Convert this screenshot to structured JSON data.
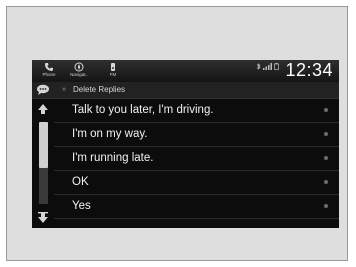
{
  "status_bar": {
    "nav_buttons": [
      {
        "label": "Phone",
        "icon": "phone-icon"
      },
      {
        "label": "Navigat..",
        "icon": "compass-icon"
      },
      {
        "label": "FM",
        "icon": "radio-icon"
      }
    ],
    "clock": "12:34"
  },
  "header": {
    "icon": "speech-bubble-icon",
    "title": "Delete Replies"
  },
  "scrollbar": {
    "position": 0.0,
    "visible_fraction": 0.56
  },
  "replies": [
    {
      "text": "Talk to you later, I'm driving."
    },
    {
      "text": "I'm on my way."
    },
    {
      "text": "I'm running late."
    },
    {
      "text": "OK"
    },
    {
      "text": "Yes"
    }
  ],
  "colors": {
    "screen_bg": "#0c0c0c",
    "text": "#f2f2f2",
    "frame_bg": "#dedede"
  }
}
